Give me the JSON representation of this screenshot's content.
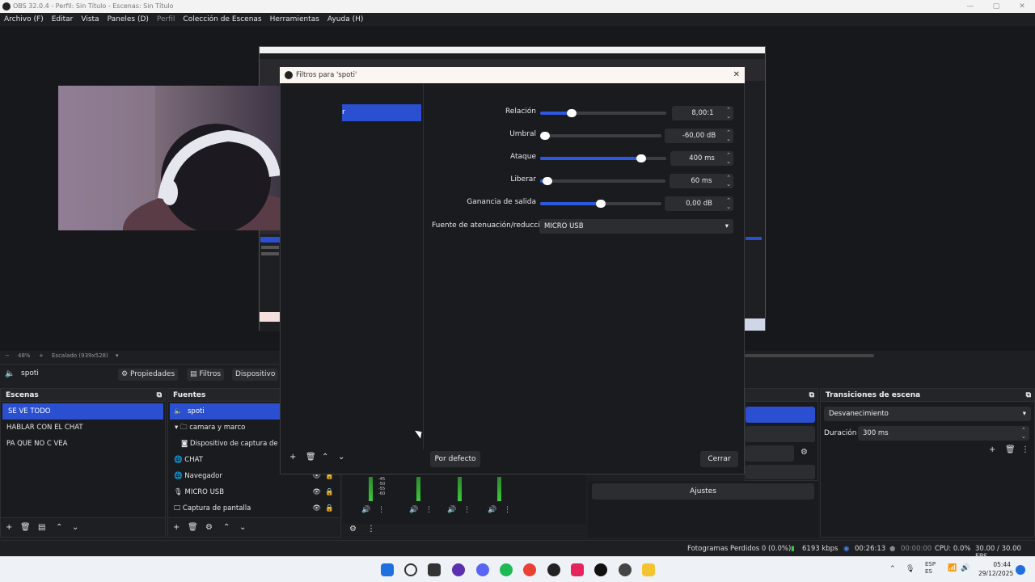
{
  "window": {
    "title": "OBS 32.0.4 - Perfil: Sin Título - Escenas: Sin Título"
  },
  "menu": [
    {
      "label": "Archivo (F)"
    },
    {
      "label": "Editar"
    },
    {
      "label": "Vista"
    },
    {
      "label": "Paneles (D)"
    },
    {
      "label": "Perfil"
    },
    {
      "label": "Colección de Escenas"
    },
    {
      "label": "Herramientas"
    },
    {
      "label": "Ayuda (H)"
    }
  ],
  "zoom": {
    "percent": "48%",
    "scale_label": "Escalado (939x528)"
  },
  "source_toolbar": {
    "source_name": "spoti",
    "properties": "Propiedades",
    "filters": "Filtros",
    "device": "Dispositivo"
  },
  "scenes": {
    "title": "Escenas",
    "items": [
      "SE VE TODO",
      "HABLAR CON EL CHAT",
      "PA QUE NO C VEA"
    ]
  },
  "sources": {
    "title": "Fuentes",
    "items": [
      "spoti",
      "camara y marco",
      "Dispositivo de captura de vi",
      "CHAT",
      "Navegador",
      "MICRO USB",
      "Captura de pantalla"
    ]
  },
  "dialog": {
    "title": "Filtros para 'spoti'",
    "filter_selected": "r",
    "props": [
      {
        "label": "Relación",
        "value": "8,00:1",
        "level": 0.25
      },
      {
        "label": "Umbral",
        "value": "-60,00 dB",
        "level": 0.0
      },
      {
        "label": "Ataque",
        "value": "400 ms",
        "level": 0.8
      },
      {
        "label": "Liberar",
        "value": "60 ms",
        "level": 0.06
      },
      {
        "label": "Ganancia de salida",
        "value": "0,00 dB",
        "level": 0.5
      }
    ],
    "sidechain_label": "Fuente de atenuación/reducción",
    "sidechain_value": "MICRO USB",
    "defaults_button": "Por defecto",
    "close_button": "Cerrar"
  },
  "mixer": {
    "ticks": [
      "-45",
      "-50",
      "-55",
      "-60"
    ]
  },
  "controls": {
    "settings": "Ajustes"
  },
  "transitions": {
    "title": "Transiciones de escena",
    "selected": "Desvanecimiento",
    "duration_label": "Duración",
    "duration_value": "300 ms"
  },
  "status": {
    "dropped": "Fotogramas Perdidos 0 (0.0%)",
    "bitrate": "6193 kbps",
    "rec_time": "00:26:13",
    "stream_time": "00:00:00",
    "cpu": "CPU: 0.0%",
    "fps": "30.00 / 30.00 FPS"
  },
  "taskbar": {
    "lang": "ESP",
    "lang2": "ES",
    "time": "05:44",
    "date": "29/12/2025"
  }
}
